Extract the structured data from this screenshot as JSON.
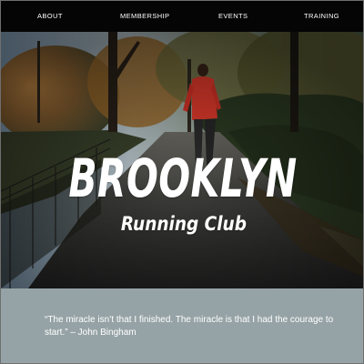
{
  "nav": {
    "items": [
      {
        "label": "ABOUT"
      },
      {
        "label": "MEMBERSHIP"
      },
      {
        "label": "EVENTS"
      },
      {
        "label": "TRAINING"
      }
    ]
  },
  "hero": {
    "title": "BROOKLYN",
    "subtitle": "Running Club"
  },
  "quote": {
    "text": "“The miracle isn’t that I finished. The miracle is that I had the courage to start.” – John Bingham"
  },
  "colors": {
    "nav_bg": "#050505",
    "quote_band_bg": "#96a3a6",
    "runner_jacket": "#e23a2c",
    "text": "#ffffff"
  }
}
